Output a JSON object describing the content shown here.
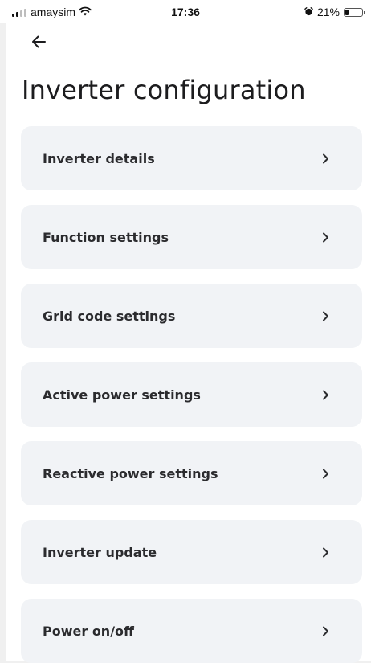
{
  "status_bar": {
    "carrier": "amaysim",
    "time": "17:36",
    "battery_text": "21%",
    "battery_level": 0.21,
    "signal_bars": [
      1,
      1,
      0,
      0
    ]
  },
  "header": {
    "back_icon": "arrow-left-icon",
    "title": "Inverter configuration"
  },
  "menu": {
    "chevron_icon": "chevron-right-icon",
    "items": [
      {
        "label": "Inverter details"
      },
      {
        "label": "Function settings"
      },
      {
        "label": "Grid code settings"
      },
      {
        "label": "Active power settings"
      },
      {
        "label": "Reactive power settings"
      },
      {
        "label": "Inverter update"
      },
      {
        "label": "Power on/off"
      }
    ]
  },
  "colors": {
    "card_background": "#f1f3f6",
    "text": "#1c1c1e"
  }
}
